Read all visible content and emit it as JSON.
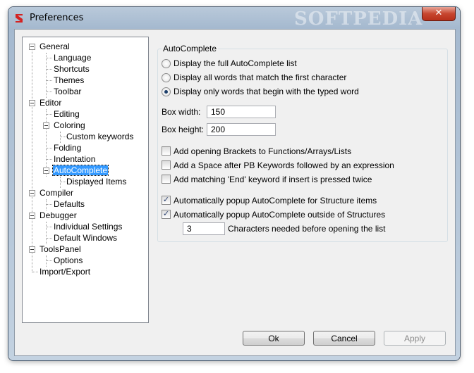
{
  "window": {
    "title": "Preferences",
    "close_glyph": "✕",
    "watermark": "SOFTPEDIA"
  },
  "tree": {
    "items": [
      {
        "label": "General"
      },
      {
        "label": "Language"
      },
      {
        "label": "Shortcuts"
      },
      {
        "label": "Themes"
      },
      {
        "label": "Toolbar"
      },
      {
        "label": "Editor"
      },
      {
        "label": "Editing"
      },
      {
        "label": "Coloring"
      },
      {
        "label": "Custom keywords"
      },
      {
        "label": "Folding"
      },
      {
        "label": "Indentation"
      },
      {
        "label": "AutoComplete"
      },
      {
        "label": "Displayed Items"
      },
      {
        "label": "Compiler"
      },
      {
        "label": "Defaults"
      },
      {
        "label": "Debugger"
      },
      {
        "label": "Individual Settings"
      },
      {
        "label": "Default Windows"
      },
      {
        "label": "ToolsPanel"
      },
      {
        "label": "Options"
      },
      {
        "label": "Import/Export"
      }
    ],
    "selected": "AutoComplete"
  },
  "autocomplete": {
    "group_title": "AutoComplete",
    "radios": [
      {
        "label": "Display the full AutoComplete list",
        "checked": false
      },
      {
        "label": "Display all words that match the first character",
        "checked": false
      },
      {
        "label": "Display only words that begin with the typed word",
        "checked": true
      }
    ],
    "box_width_label": "Box width:",
    "box_width_value": "150",
    "box_height_label": "Box height:",
    "box_height_value": "200",
    "checks": [
      {
        "label": "Add opening Brackets to Functions/Arrays/Lists",
        "checked": false
      },
      {
        "label": "Add a Space after PB Keywords followed by an expression",
        "checked": false
      },
      {
        "label": "Add matching 'End' keyword if insert is pressed twice",
        "checked": false
      },
      {
        "label": "Automatically popup AutoComplete for Structure items",
        "checked": true
      },
      {
        "label": "Automatically popup AutoComplete outside of Structures",
        "checked": true
      }
    ],
    "chars_needed_value": "3",
    "chars_needed_label": "Characters needed before opening the list"
  },
  "buttons": {
    "ok": "Ok",
    "cancel": "Cancel",
    "apply": "Apply"
  },
  "colors": {
    "selection": "#3399ff",
    "check_mark": "#2a3f6e"
  }
}
